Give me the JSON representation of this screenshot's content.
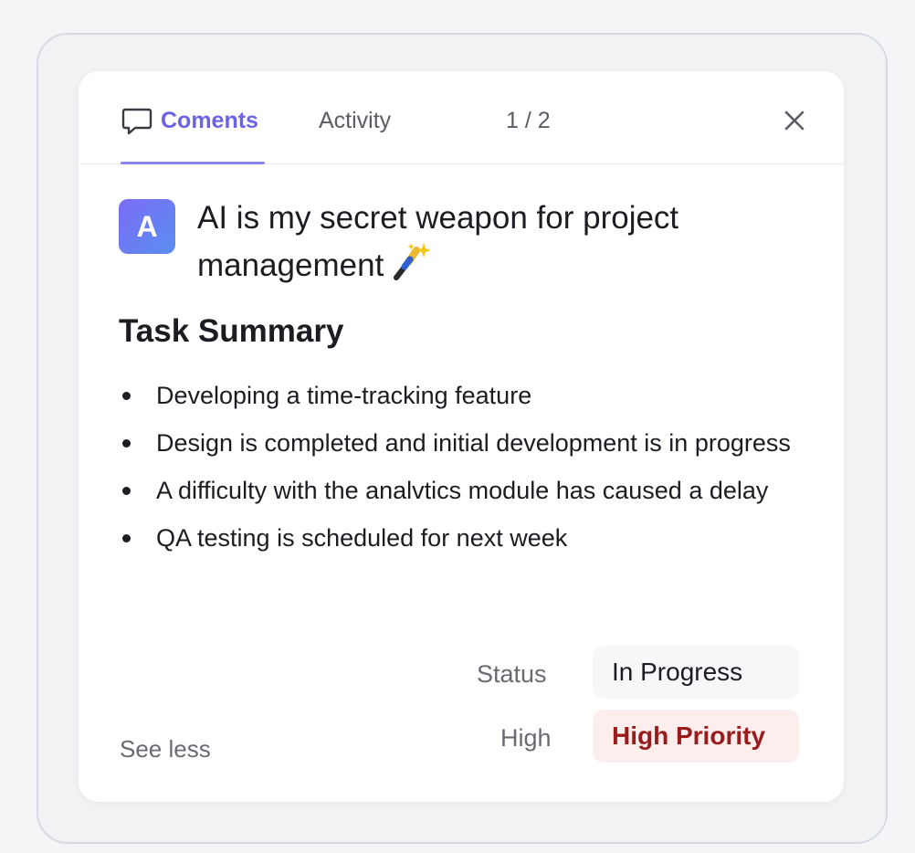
{
  "tabs": {
    "comments_label": "Coments",
    "activity_label": "Activity",
    "pager": "1 / 2"
  },
  "comment": {
    "avatar_initial": "A",
    "headline": "AI is my secret weapon for project management",
    "emoji_icon": "magic-wand-sparkles-icon"
  },
  "summary": {
    "title": "Task Summary",
    "items": [
      "Developing a time-tracking feature",
      "Design is completed and initial development is in progress",
      "A difficulty with the analvtics module has caused a delay",
      "QA testing is scheduled for next week"
    ]
  },
  "details": {
    "status_label": "Status",
    "status_value": "In Progress",
    "priority_label": "High",
    "priority_value": "High Priority"
  },
  "footer": {
    "see_less": "See less"
  },
  "colors": {
    "accent": "#6b63e6",
    "priority_text": "#991b1b",
    "priority_bg": "#fdeeee"
  }
}
